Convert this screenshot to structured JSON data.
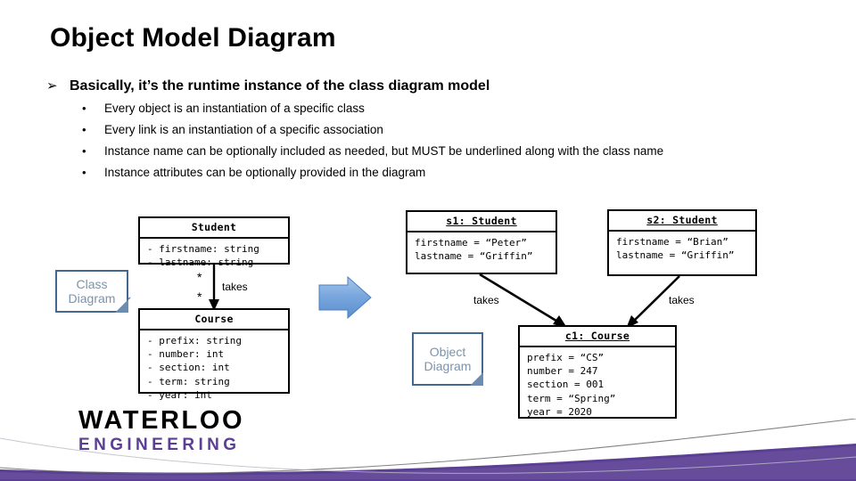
{
  "slide": {
    "title": "Object Model Diagram",
    "bullets": {
      "level1_marker": "➢",
      "level1_text": "Basically, it’s the runtime instance of the class diagram model",
      "level2_marker": "•",
      "level2_items": [
        "Every object is an instantiation of a specific class",
        "Every link is an instantiation of a specific association",
        "Instance name can be optionally included as needed, but MUST be underlined along with the class name",
        "Instance attributes can be optionally provided in the diagram"
      ]
    }
  },
  "class_diagram": {
    "note_label_line1": "Class",
    "note_label_line2": "Diagram",
    "student": {
      "name": "Student",
      "attributes": [
        "- firstname: string",
        "- lastname: string"
      ]
    },
    "course": {
      "name": "Course",
      "attributes": [
        "- prefix: string",
        "- number: int",
        "- section: int",
        "- term: string",
        "- year: int"
      ]
    },
    "association": {
      "label": "takes",
      "multiplicity_source": "*",
      "multiplicity_target": "*"
    }
  },
  "object_diagram": {
    "note_label_line1": "Object",
    "note_label_line2": "Diagram",
    "s1": {
      "name": "s1: Student",
      "attributes": [
        "firstname = “Peter”",
        "lastname = “Griffin”"
      ]
    },
    "s2": {
      "name": "s2: Student",
      "attributes": [
        "firstname = “Brian”",
        "lastname = “Griffin”"
      ]
    },
    "c1": {
      "name": "c1: Course",
      "attributes": [
        "prefix = “CS”",
        "number = 247",
        "section = 001",
        "term = “Spring”",
        "year = 2020"
      ]
    },
    "link_left_label": "takes",
    "link_right_label": "takes"
  },
  "logo": {
    "primary": "WATERLOO",
    "secondary": "ENGINEERING"
  },
  "colors": {
    "brand_purple": "#5b3f94",
    "note_border": "#44698f",
    "note_text": "#7c93ab",
    "arrow_blue": "#6d9bd8"
  }
}
